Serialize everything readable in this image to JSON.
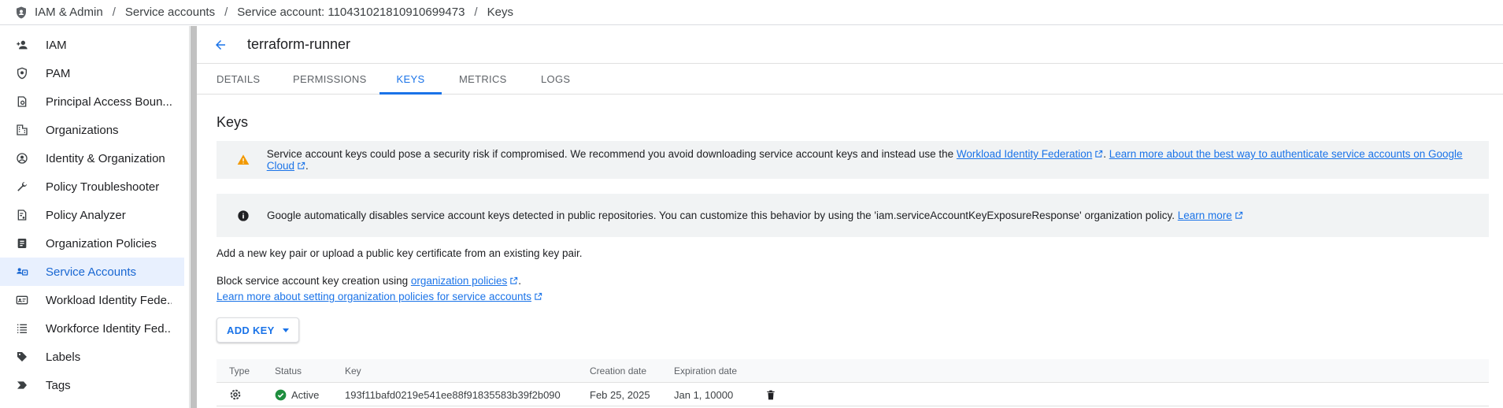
{
  "breadcrumb": {
    "items": [
      "IAM & Admin",
      "Service accounts",
      "Service account: 110431021810910699473",
      "Keys"
    ],
    "separator": "/"
  },
  "sidebar": {
    "items": [
      {
        "label": "IAM",
        "icon": "person-add-icon"
      },
      {
        "label": "PAM",
        "icon": "shield-icon"
      },
      {
        "label": "Principal Access Boun...",
        "icon": "policy-icon"
      },
      {
        "label": "Organizations",
        "icon": "building-icon"
      },
      {
        "label": "Identity & Organization",
        "icon": "account-circle-icon"
      },
      {
        "label": "Policy Troubleshooter",
        "icon": "wrench-icon"
      },
      {
        "label": "Policy Analyzer",
        "icon": "document-search-icon"
      },
      {
        "label": "Organization Policies",
        "icon": "list-document-icon"
      },
      {
        "label": "Service Accounts",
        "icon": "service-account-icon",
        "active": true
      },
      {
        "label": "Workload Identity Fede...",
        "icon": "badge-icon"
      },
      {
        "label": "Workforce Identity Fed...",
        "icon": "list-icon"
      },
      {
        "label": "Labels",
        "icon": "tag-icon"
      },
      {
        "label": "Tags",
        "icon": "chevron-tag-icon"
      }
    ]
  },
  "header": {
    "title": "terraform-runner"
  },
  "tabs": [
    {
      "label": "DETAILS"
    },
    {
      "label": "PERMISSIONS"
    },
    {
      "label": "KEYS",
      "active": true
    },
    {
      "label": "METRICS"
    },
    {
      "label": "LOGS"
    }
  ],
  "keys": {
    "title": "Keys",
    "warning": {
      "text": "Service account keys could pose a security risk if compromised. We recommend you avoid downloading service account keys and instead use the ",
      "link1": "Workload Identity Federation",
      "mid": ". ",
      "link2": "Learn more about the best way to authenticate service accounts on Google Cloud",
      "end": "."
    },
    "info": {
      "text": "Google automatically disables service account keys detected in public repositories. You can customize this behavior by using the 'iam.serviceAccountKeyExposureResponse' organization policy. ",
      "link": "Learn more"
    },
    "add_text": "Add a new key pair or upload a public key certificate from an existing key pair.",
    "block_text": "Block service account key creation using ",
    "block_link": "organization policies",
    "block_end": ".",
    "learn_link": "Learn more about setting organization policies for service accounts",
    "add_key_label": "ADD KEY"
  },
  "table": {
    "columns": [
      "Type",
      "Status",
      "Key",
      "Creation date",
      "Expiration date"
    ],
    "rows": [
      {
        "type_icon": "gear-icon",
        "status": "Active",
        "key": "193f11bafd0219e541ee88f91835583b39f2b090",
        "created": "Feb 25, 2025",
        "expires": "Jan 1, 10000"
      }
    ]
  },
  "colors": {
    "accent": "#1a73e8",
    "active_bg": "#e8f0fe",
    "warning": "#f29900",
    "success": "#1e8e3e"
  }
}
